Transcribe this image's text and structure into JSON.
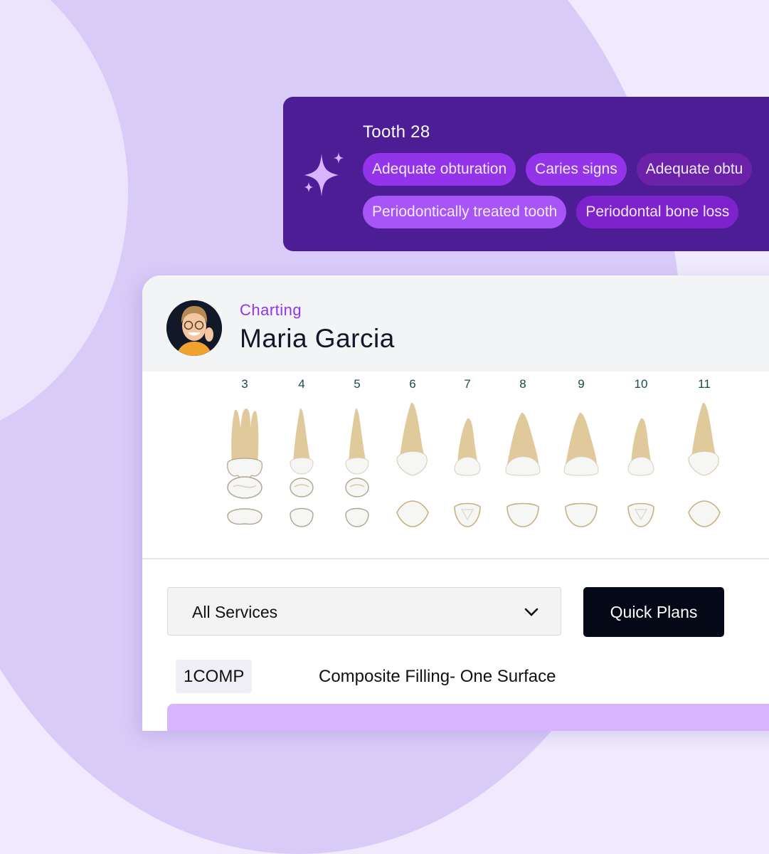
{
  "ai_findings": {
    "title": "Tooth 28",
    "icon": "sparkle-icon",
    "chips": [
      {
        "label": "Adequate obturation",
        "color": "#9333ea"
      },
      {
        "label": "Caries signs",
        "color": "#9333ea"
      },
      {
        "label": "Adequate obtu",
        "color": "#6b21a8"
      },
      {
        "label": "Periodontically treated tooth",
        "color": "#a855f7"
      },
      {
        "label": "Periodontal bone loss",
        "color": "#7e22ce"
      }
    ]
  },
  "header": {
    "eyebrow": "Charting",
    "patient_name": "Maria Garcia",
    "avatar": "patient-avatar"
  },
  "teeth": [
    {
      "number": "3",
      "type": "molar"
    },
    {
      "number": "4",
      "type": "premolar"
    },
    {
      "number": "5",
      "type": "premolar"
    },
    {
      "number": "6",
      "type": "canine"
    },
    {
      "number": "7",
      "type": "lateral-incisor"
    },
    {
      "number": "8",
      "type": "central-incisor"
    },
    {
      "number": "9",
      "type": "central-incisor"
    },
    {
      "number": "10",
      "type": "lateral-incisor"
    },
    {
      "number": "11",
      "type": "canine"
    }
  ],
  "toolbar": {
    "services_select": "All Services",
    "quick_plans_label": "Quick Plans"
  },
  "services": [
    {
      "code": "1COMP",
      "description": "Composite Filling- One Surface"
    }
  ],
  "colors": {
    "accent": "#9333ea",
    "card_bg": "#4c1d95",
    "tooth_number": "#134e4a",
    "button_dark": "#050816"
  }
}
